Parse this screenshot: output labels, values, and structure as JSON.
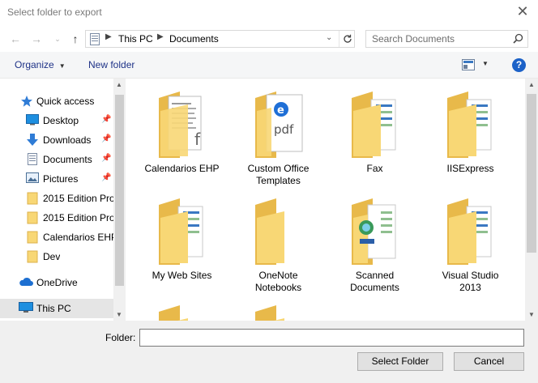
{
  "window": {
    "title": "Select folder to export"
  },
  "nav": {
    "breadcrumbs": [
      "This PC",
      "Documents"
    ],
    "search_placeholder": "Search Documents"
  },
  "toolbar": {
    "organize": "Organize",
    "new_folder": "New folder"
  },
  "sidebar": {
    "items": [
      {
        "label": "Quick access",
        "icon": "star-icon"
      },
      {
        "label": "Desktop",
        "icon": "desktop-icon",
        "pinned": true
      },
      {
        "label": "Downloads",
        "icon": "download-icon",
        "pinned": true
      },
      {
        "label": "Documents",
        "icon": "document-icon",
        "pinned": true
      },
      {
        "label": "Pictures",
        "icon": "pictures-icon",
        "pinned": true
      },
      {
        "label": "2015 Edition Pro",
        "icon": "folder-icon"
      },
      {
        "label": "2015 Edition Pro",
        "icon": "folder-icon"
      },
      {
        "label": "Calendarios EHP",
        "icon": "folder-icon"
      },
      {
        "label": "Dev",
        "icon": "folder-icon"
      },
      {
        "label": "OneDrive",
        "icon": "cloud-icon"
      },
      {
        "label": "This PC",
        "icon": "computer-icon",
        "selected": true
      }
    ]
  },
  "folders": [
    {
      "caption": "Calendarios EHP",
      "icon": "document-folder-icon"
    },
    {
      "caption": "Custom Office Templates",
      "icon": "pdf-folder-icon"
    },
    {
      "caption": "Fax",
      "icon": "folder-icon"
    },
    {
      "caption": "IISExpress",
      "icon": "folder-icon"
    },
    {
      "caption": "My Web Sites",
      "icon": "folder-icon"
    },
    {
      "caption": "OneNote Notebooks",
      "icon": "empty-folder-icon"
    },
    {
      "caption": "Scanned Documents",
      "icon": "scanned-folder-icon"
    },
    {
      "caption": "Visual Studio 2013",
      "icon": "folder-icon"
    },
    {
      "caption": "",
      "icon": "folder-icon"
    },
    {
      "caption": "",
      "icon": "folder-icon"
    }
  ],
  "footer": {
    "folder_label": "Folder:",
    "folder_value": "",
    "select_button": "Select Folder",
    "cancel_button": "Cancel"
  },
  "colors": {
    "link": "#1e3287",
    "folder": "#f8d775",
    "folder_dark": "#e8b94a",
    "help": "#1c62c8"
  }
}
